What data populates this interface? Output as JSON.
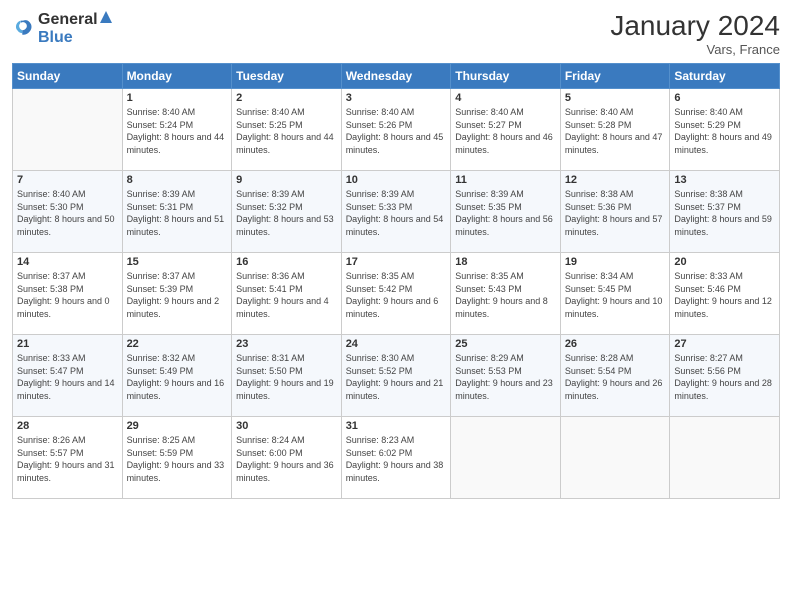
{
  "header": {
    "logo_general": "General",
    "logo_blue": "Blue",
    "month_title": "January 2024",
    "location": "Vars, France"
  },
  "weekdays": [
    "Sunday",
    "Monday",
    "Tuesday",
    "Wednesday",
    "Thursday",
    "Friday",
    "Saturday"
  ],
  "weeks": [
    [
      {
        "day": "",
        "sunrise": "",
        "sunset": "",
        "daylight": ""
      },
      {
        "day": "1",
        "sunrise": "Sunrise: 8:40 AM",
        "sunset": "Sunset: 5:24 PM",
        "daylight": "Daylight: 8 hours and 44 minutes."
      },
      {
        "day": "2",
        "sunrise": "Sunrise: 8:40 AM",
        "sunset": "Sunset: 5:25 PM",
        "daylight": "Daylight: 8 hours and 44 minutes."
      },
      {
        "day": "3",
        "sunrise": "Sunrise: 8:40 AM",
        "sunset": "Sunset: 5:26 PM",
        "daylight": "Daylight: 8 hours and 45 minutes."
      },
      {
        "day": "4",
        "sunrise": "Sunrise: 8:40 AM",
        "sunset": "Sunset: 5:27 PM",
        "daylight": "Daylight: 8 hours and 46 minutes."
      },
      {
        "day": "5",
        "sunrise": "Sunrise: 8:40 AM",
        "sunset": "Sunset: 5:28 PM",
        "daylight": "Daylight: 8 hours and 47 minutes."
      },
      {
        "day": "6",
        "sunrise": "Sunrise: 8:40 AM",
        "sunset": "Sunset: 5:29 PM",
        "daylight": "Daylight: 8 hours and 49 minutes."
      }
    ],
    [
      {
        "day": "7",
        "sunrise": "Sunrise: 8:40 AM",
        "sunset": "Sunset: 5:30 PM",
        "daylight": "Daylight: 8 hours and 50 minutes."
      },
      {
        "day": "8",
        "sunrise": "Sunrise: 8:39 AM",
        "sunset": "Sunset: 5:31 PM",
        "daylight": "Daylight: 8 hours and 51 minutes."
      },
      {
        "day": "9",
        "sunrise": "Sunrise: 8:39 AM",
        "sunset": "Sunset: 5:32 PM",
        "daylight": "Daylight: 8 hours and 53 minutes."
      },
      {
        "day": "10",
        "sunrise": "Sunrise: 8:39 AM",
        "sunset": "Sunset: 5:33 PM",
        "daylight": "Daylight: 8 hours and 54 minutes."
      },
      {
        "day": "11",
        "sunrise": "Sunrise: 8:39 AM",
        "sunset": "Sunset: 5:35 PM",
        "daylight": "Daylight: 8 hours and 56 minutes."
      },
      {
        "day": "12",
        "sunrise": "Sunrise: 8:38 AM",
        "sunset": "Sunset: 5:36 PM",
        "daylight": "Daylight: 8 hours and 57 minutes."
      },
      {
        "day": "13",
        "sunrise": "Sunrise: 8:38 AM",
        "sunset": "Sunset: 5:37 PM",
        "daylight": "Daylight: 8 hours and 59 minutes."
      }
    ],
    [
      {
        "day": "14",
        "sunrise": "Sunrise: 8:37 AM",
        "sunset": "Sunset: 5:38 PM",
        "daylight": "Daylight: 9 hours and 0 minutes."
      },
      {
        "day": "15",
        "sunrise": "Sunrise: 8:37 AM",
        "sunset": "Sunset: 5:39 PM",
        "daylight": "Daylight: 9 hours and 2 minutes."
      },
      {
        "day": "16",
        "sunrise": "Sunrise: 8:36 AM",
        "sunset": "Sunset: 5:41 PM",
        "daylight": "Daylight: 9 hours and 4 minutes."
      },
      {
        "day": "17",
        "sunrise": "Sunrise: 8:35 AM",
        "sunset": "Sunset: 5:42 PM",
        "daylight": "Daylight: 9 hours and 6 minutes."
      },
      {
        "day": "18",
        "sunrise": "Sunrise: 8:35 AM",
        "sunset": "Sunset: 5:43 PM",
        "daylight": "Daylight: 9 hours and 8 minutes."
      },
      {
        "day": "19",
        "sunrise": "Sunrise: 8:34 AM",
        "sunset": "Sunset: 5:45 PM",
        "daylight": "Daylight: 9 hours and 10 minutes."
      },
      {
        "day": "20",
        "sunrise": "Sunrise: 8:33 AM",
        "sunset": "Sunset: 5:46 PM",
        "daylight": "Daylight: 9 hours and 12 minutes."
      }
    ],
    [
      {
        "day": "21",
        "sunrise": "Sunrise: 8:33 AM",
        "sunset": "Sunset: 5:47 PM",
        "daylight": "Daylight: 9 hours and 14 minutes."
      },
      {
        "day": "22",
        "sunrise": "Sunrise: 8:32 AM",
        "sunset": "Sunset: 5:49 PM",
        "daylight": "Daylight: 9 hours and 16 minutes."
      },
      {
        "day": "23",
        "sunrise": "Sunrise: 8:31 AM",
        "sunset": "Sunset: 5:50 PM",
        "daylight": "Daylight: 9 hours and 19 minutes."
      },
      {
        "day": "24",
        "sunrise": "Sunrise: 8:30 AM",
        "sunset": "Sunset: 5:52 PM",
        "daylight": "Daylight: 9 hours and 21 minutes."
      },
      {
        "day": "25",
        "sunrise": "Sunrise: 8:29 AM",
        "sunset": "Sunset: 5:53 PM",
        "daylight": "Daylight: 9 hours and 23 minutes."
      },
      {
        "day": "26",
        "sunrise": "Sunrise: 8:28 AM",
        "sunset": "Sunset: 5:54 PM",
        "daylight": "Daylight: 9 hours and 26 minutes."
      },
      {
        "day": "27",
        "sunrise": "Sunrise: 8:27 AM",
        "sunset": "Sunset: 5:56 PM",
        "daylight": "Daylight: 9 hours and 28 minutes."
      }
    ],
    [
      {
        "day": "28",
        "sunrise": "Sunrise: 8:26 AM",
        "sunset": "Sunset: 5:57 PM",
        "daylight": "Daylight: 9 hours and 31 minutes."
      },
      {
        "day": "29",
        "sunrise": "Sunrise: 8:25 AM",
        "sunset": "Sunset: 5:59 PM",
        "daylight": "Daylight: 9 hours and 33 minutes."
      },
      {
        "day": "30",
        "sunrise": "Sunrise: 8:24 AM",
        "sunset": "Sunset: 6:00 PM",
        "daylight": "Daylight: 9 hours and 36 minutes."
      },
      {
        "day": "31",
        "sunrise": "Sunrise: 8:23 AM",
        "sunset": "Sunset: 6:02 PM",
        "daylight": "Daylight: 9 hours and 38 minutes."
      },
      {
        "day": "",
        "sunrise": "",
        "sunset": "",
        "daylight": ""
      },
      {
        "day": "",
        "sunrise": "",
        "sunset": "",
        "daylight": ""
      },
      {
        "day": "",
        "sunrise": "",
        "sunset": "",
        "daylight": ""
      }
    ]
  ]
}
